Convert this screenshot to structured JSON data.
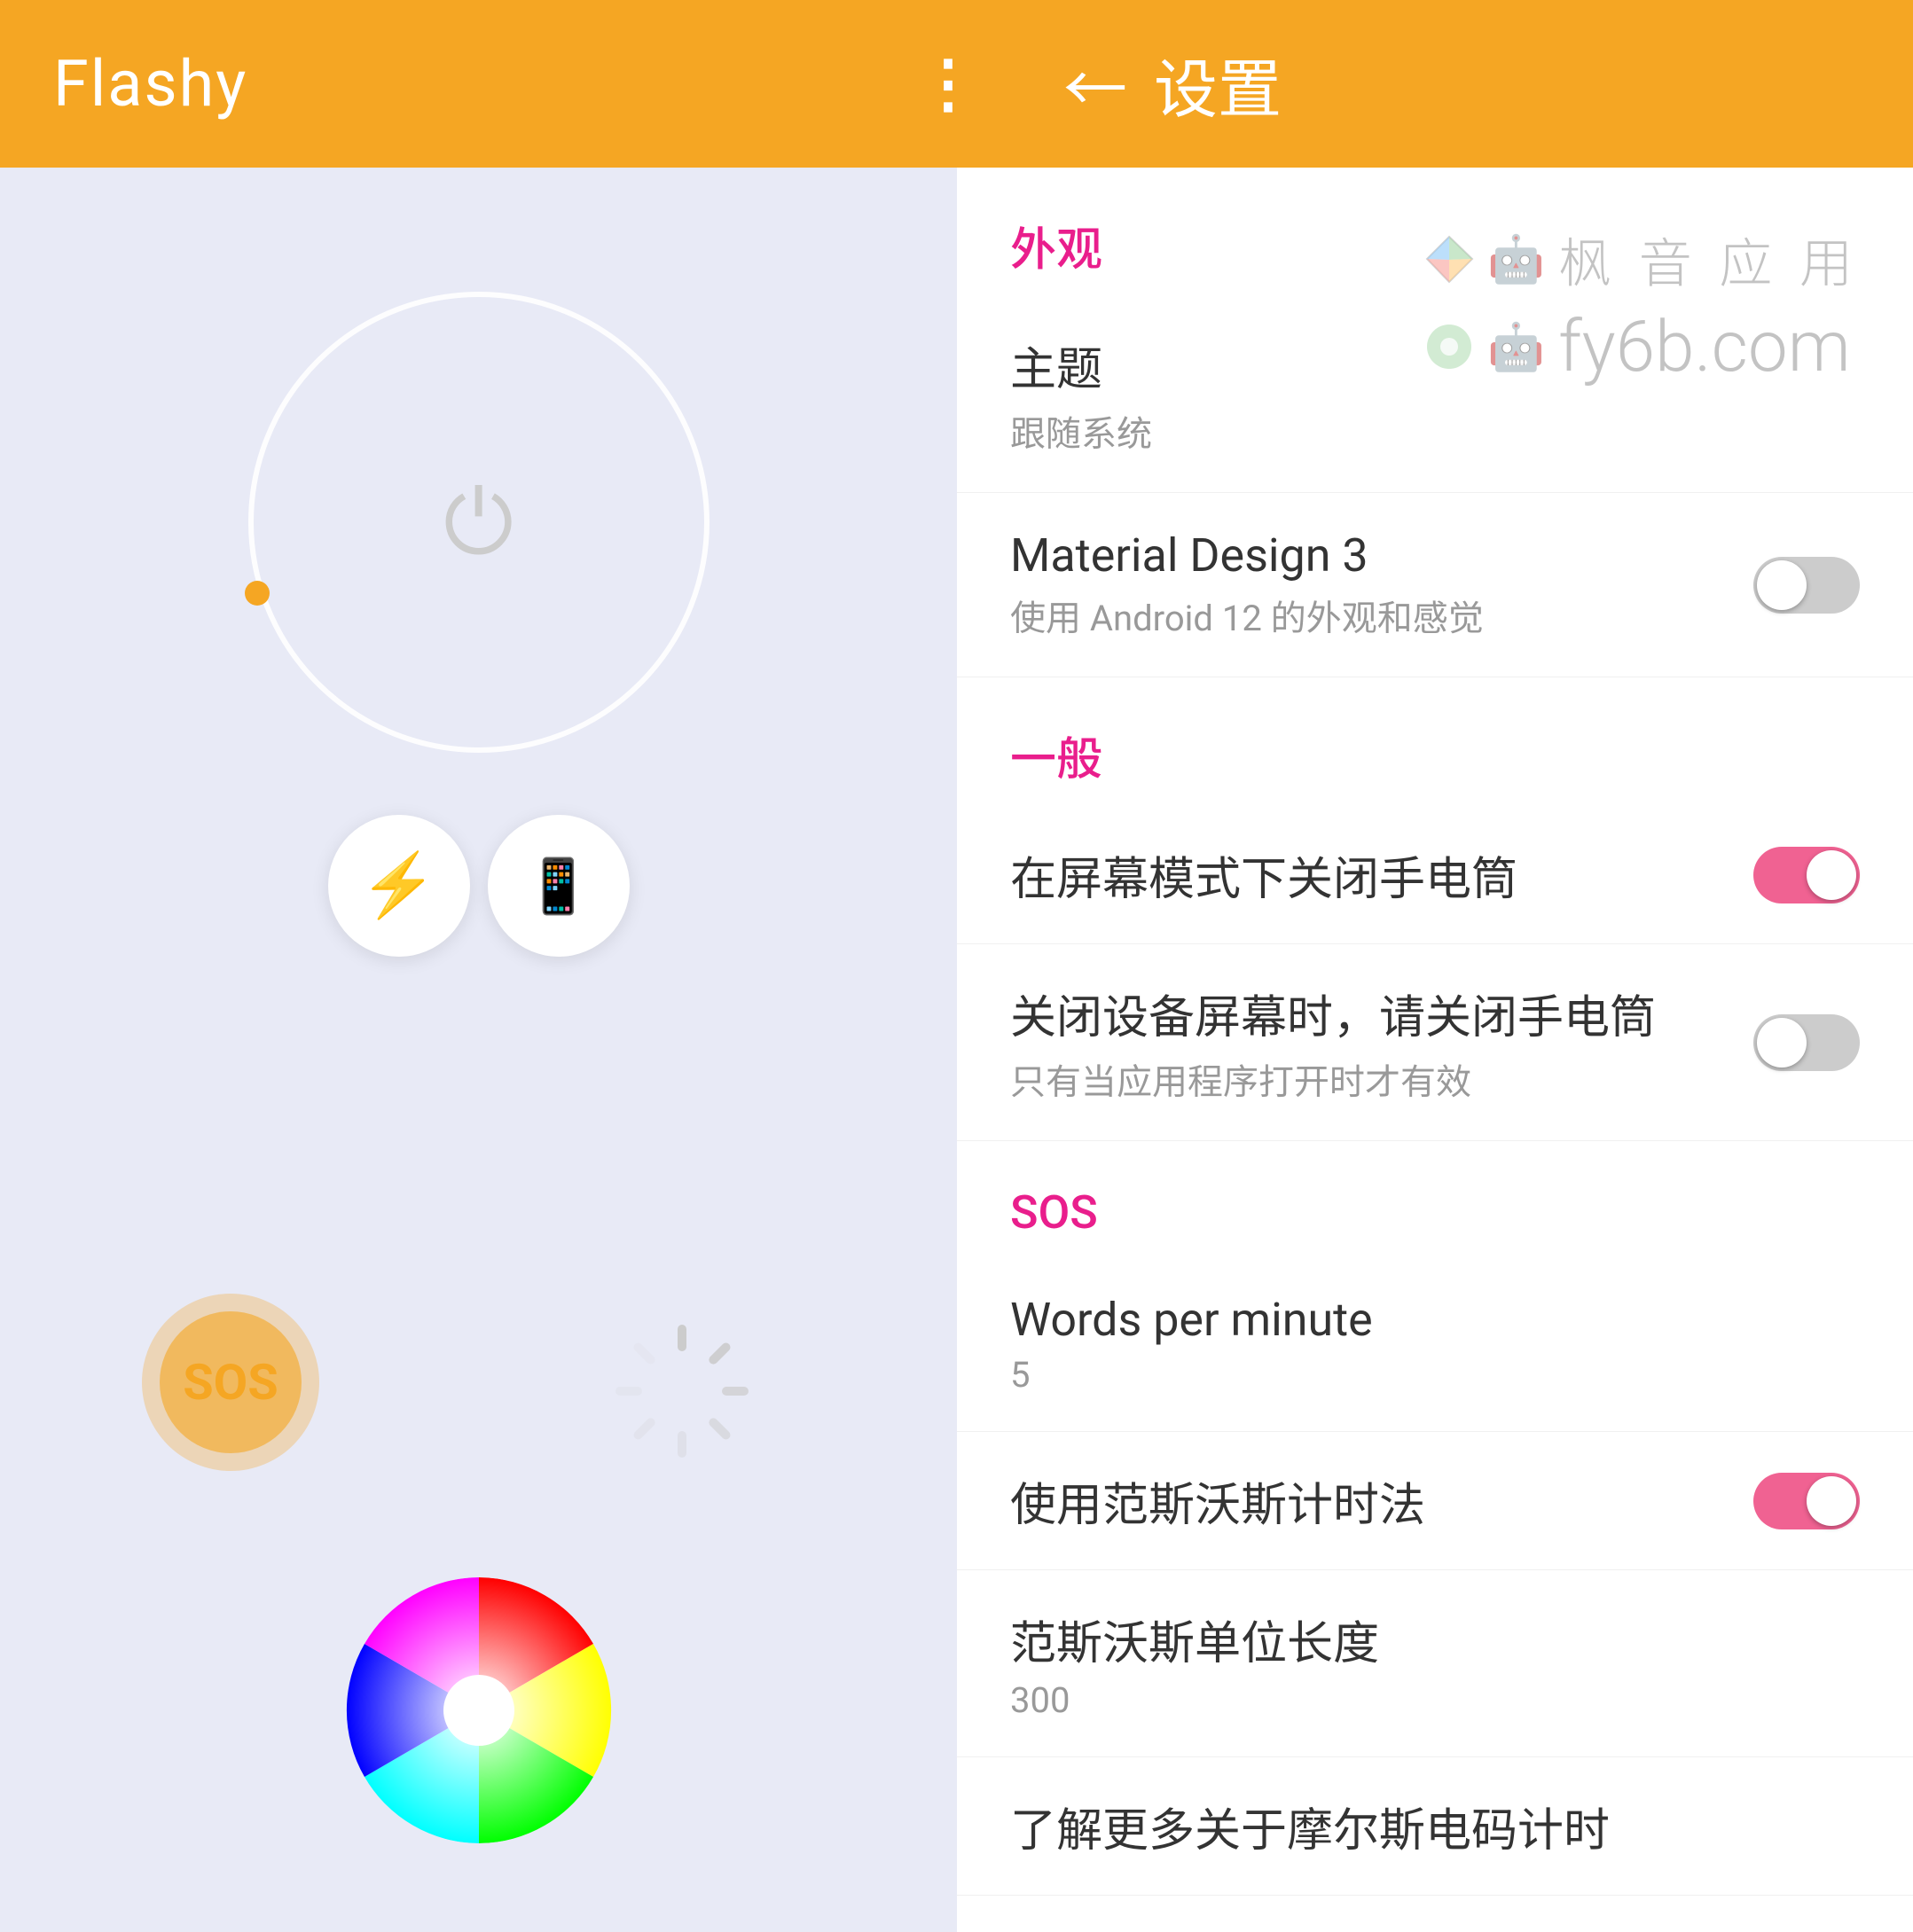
{
  "app": {
    "title": "Flashy"
  },
  "topbar": {
    "title": "Flashy",
    "more_icon": "⋮",
    "back_icon": "←",
    "settings_label": "设置"
  },
  "settings": {
    "section_appearance": "外观",
    "theme_label": "主题",
    "theme_value": "跟随系统",
    "material_design_label": "Material Design 3",
    "material_design_desc": "使用 Android 12 的外观和感觉",
    "material_design_enabled": false,
    "section_general": "一般",
    "screen_off_torch_label": "在屏幕模式下关闭手电筒",
    "screen_off_torch_enabled": true,
    "device_sleep_label": "关闭设备屏幕时，请关闭手电筒",
    "device_sleep_desc": "只有当应用程序打开时才有效",
    "device_sleep_enabled": false,
    "section_sos": "SOS",
    "wpm_label": "Words per minute",
    "wpm_value": "5",
    "farnsworth_label": "使用范斯沃斯计时法",
    "farnsworth_enabled": true,
    "farnsworth_unit_label": "范斯沃斯单位长度",
    "farnsworth_unit_value": "300",
    "morse_timing_label": "了解更多关于摩尔斯电码计时"
  },
  "left_panel": {
    "sos_label": "SOS"
  },
  "watermark": {
    "text_cn": "枫 音 应 用",
    "text_en": "fy6b.com"
  }
}
